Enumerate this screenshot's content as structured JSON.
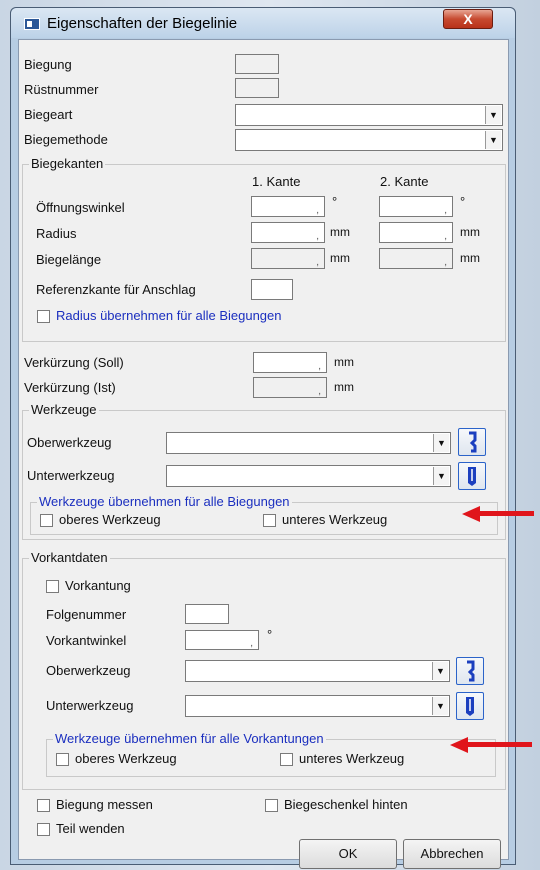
{
  "window": {
    "title": "Eigenschaften der Biegelinie",
    "close_label": "X"
  },
  "fields": {
    "biegung": "Biegung",
    "ruestnummer": "Rüstnummer",
    "biegeart": "Biegeart",
    "biegemethode": "Biegemethode"
  },
  "biegekanten": {
    "title": "Biegekanten",
    "col1": "1. Kante",
    "col2": "2. Kante",
    "oeffnungswinkel": "Öffnungswinkel",
    "radius": "Radius",
    "biegelaenge": "Biegelänge",
    "deg": "°",
    "mm": "mm",
    "referenzkante": "Referenzkante für Anschlag",
    "radius_uebernehmen": "Radius übernehmen für alle Biegungen"
  },
  "verkuerzung": {
    "soll": "Verkürzung (Soll)",
    "ist": "Verkürzung (Ist)",
    "unit": "mm"
  },
  "werkzeuge": {
    "title": "Werkzeuge",
    "oberwerkzeug": "Oberwerkzeug",
    "unterwerkzeug": "Unterwerkzeug",
    "uebernehmen_title": "Werkzeuge übernehmen für alle Biegungen",
    "oberes": "oberes Werkzeug",
    "unteres": "unteres Werkzeug"
  },
  "vorkantdaten": {
    "title": "Vorkantdaten",
    "vorkantung": "Vorkantung",
    "folgenummer": "Folgenummer",
    "vorkantwinkel": "Vorkantwinkel",
    "deg": "°",
    "oberwerkzeug": "Oberwerkzeug",
    "unterwerkzeug": "Unterwerkzeug",
    "uebernehmen_title": "Werkzeuge übernehmen für alle Vorkantungen",
    "oberes": "oberes Werkzeug",
    "unteres": "unteres Werkzeug"
  },
  "bottom": {
    "biegung_messen": "Biegung messen",
    "biegeschenkel_hinten": "Biegeschenkel hinten",
    "teil_wenden": "Teil wenden",
    "ok": "OK",
    "abbrechen": "Abbrechen"
  },
  "colors": {
    "accent": "#1b2fbf",
    "arrow": "#e0151b"
  }
}
